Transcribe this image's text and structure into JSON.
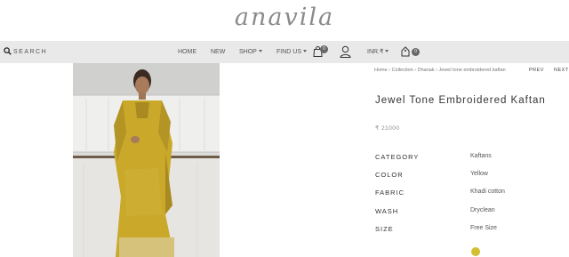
{
  "brand": {
    "logo_text": "anavila"
  },
  "nav": {
    "search_label": "SEARCH",
    "links": [
      "HOME",
      "NEW",
      "SHOP",
      "FIND US"
    ],
    "cart_count": "0",
    "currency": "INR.₹",
    "wishlist_count": "0"
  },
  "breadcrumb": [
    "Home",
    "Collection",
    "Dhanak",
    "Jewel tone embroidered kaftan"
  ],
  "breadcrumb_separator": "›",
  "pager": {
    "prev": "PREV",
    "next": "NEXT"
  },
  "product": {
    "title": "Jewel Tone Embroidered Kaftan",
    "price": "₹ 21000",
    "attributes": [
      {
        "label": "CATEGORY",
        "value": "Kaftans"
      },
      {
        "label": "COLOR",
        "value": "Yellow"
      },
      {
        "label": "FABRIC",
        "value": "Khadi cotton"
      },
      {
        "label": "WASH",
        "value": "Dryclean"
      },
      {
        "label": "SIZE",
        "value": "Free Size"
      }
    ],
    "swatch_color": "#d4bf32"
  },
  "colors": {
    "nav_bg": "#e9e9e9",
    "garment": "#c9a82a"
  }
}
